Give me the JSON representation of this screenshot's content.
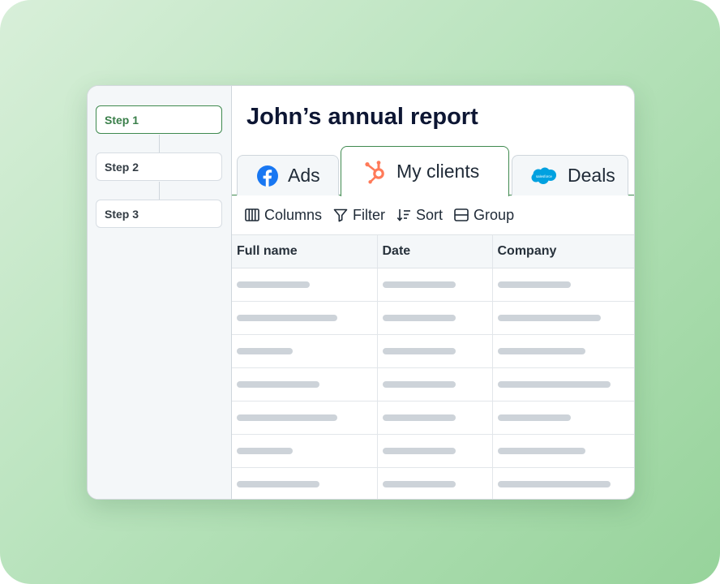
{
  "steps": [
    {
      "label": "Step 1",
      "active": true
    },
    {
      "label": "Step 2",
      "active": false
    },
    {
      "label": "Step 3",
      "active": false
    }
  ],
  "report": {
    "title": "John’s annual report"
  },
  "tabs": [
    {
      "label": "Ads",
      "icon": "facebook-icon",
      "active": false
    },
    {
      "label": "My clients",
      "icon": "hubspot-icon",
      "active": true
    },
    {
      "label": "Deals",
      "icon": "salesforce-icon",
      "active": false
    }
  ],
  "salesforce_logo_text": "salesforce",
  "toolbar": {
    "columns_label": "Columns",
    "filter_label": "Filter",
    "sort_label": "Sort",
    "group_label": "Group"
  },
  "table": {
    "headers": [
      "Full name",
      "Date",
      "Company"
    ]
  },
  "colors": {
    "accent": "#3f8a4f",
    "facebook": "#1877f2",
    "hubspot": "#ff7a59",
    "salesforce": "#00a1e0",
    "placeholder": "#cdd3d9"
  }
}
